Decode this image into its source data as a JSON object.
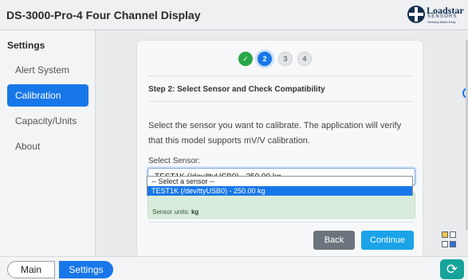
{
  "app": {
    "title": "DS-3000-Pro-4 Four Channel Display"
  },
  "logo": {
    "name": "Loadstar",
    "sub": "SENSORS",
    "tagline": "Sensing Made Easy"
  },
  "sidebar": {
    "title": "Settings",
    "items": [
      {
        "label": "Alert System"
      },
      {
        "label": "Calibration",
        "active": true
      },
      {
        "label": "Capacity/Units"
      },
      {
        "label": "About"
      }
    ]
  },
  "stepper": {
    "steps": [
      "✓",
      "2",
      "3",
      "4"
    ],
    "current": 2
  },
  "step": {
    "heading": "Step 2: Select Sensor and Check Compatibility",
    "description": "Select the sensor you want to calibrate. The application will verify that this model supports mV/V calibration."
  },
  "sensor_select": {
    "label": "Select Sensor:",
    "value": "TEST1K (/dev/ttyUSB0) - 250.00 kg",
    "options": [
      "-- Select a sensor --",
      "TEST1K (/dev/ttyUSB0) - 250.00 kg"
    ],
    "highlighted_index": 1
  },
  "compat": {
    "units_label": "Sensor units:",
    "units_value": "kg"
  },
  "buttons": {
    "back": "Back",
    "continue": "Continue"
  },
  "footer": {
    "main_tab": "Main",
    "settings_tab": "Settings",
    "refresh_icon": "refresh-icon"
  },
  "colors": {
    "accent": "#1877e8",
    "success": "#28a745",
    "continue": "#1aa3e8",
    "refresh": "#16a39a"
  }
}
